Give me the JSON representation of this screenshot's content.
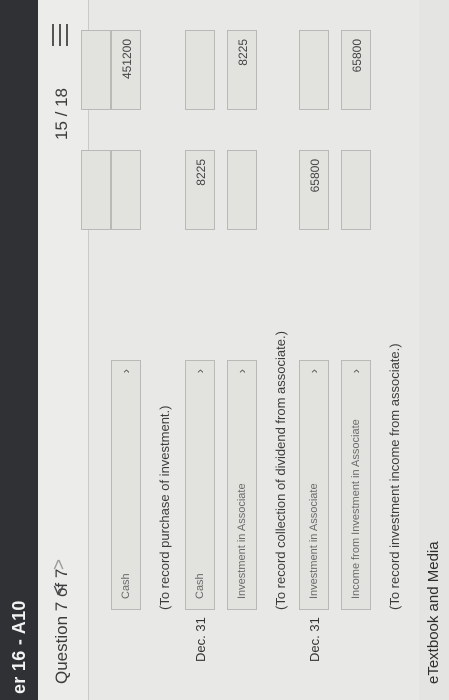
{
  "topbar": {
    "title": "er 16 - A10"
  },
  "header": {
    "question_label": "Question 7 of 7",
    "prev": "<",
    "next": ">",
    "score": "15 / 18"
  },
  "rows": [
    {
      "date": "",
      "account": "Cash",
      "debit": "",
      "credit": "451200"
    },
    {
      "note": "(To record purchase of investment.)"
    },
    {
      "date": "Dec. 31",
      "account": "Cash",
      "debit": "8225",
      "credit": ""
    },
    {
      "date": "",
      "account": "Investment in Associate",
      "debit": "",
      "credit": "8225"
    },
    {
      "note": "(To record collection of dividend from associate.)"
    },
    {
      "date": "Dec. 31",
      "account": "Investment in Associate",
      "debit": "65800",
      "credit": ""
    },
    {
      "date": "",
      "account": "Income from Investment in Associate",
      "debit": "",
      "credit": "65800"
    },
    {
      "note": "(To record investment income from associate.)"
    }
  ],
  "footer": {
    "ebook": "eTextbook and Media"
  },
  "icons": {
    "chevron": "chevron-down-icon",
    "menu": "hamburger-icon"
  }
}
